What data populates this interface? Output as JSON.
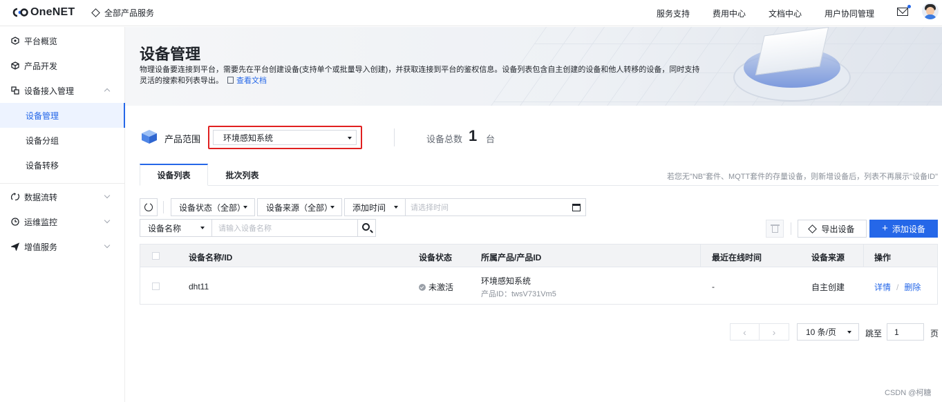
{
  "topbar": {
    "logo_text": "OneNET",
    "all_products": "全部产品服务",
    "nav": [
      "服务支持",
      "费用中心",
      "文档中心",
      "用户协同管理"
    ],
    "icons": {
      "mail": "mail-icon",
      "avatar": "user-avatar"
    }
  },
  "sidebar": {
    "items": [
      {
        "label": "平台概览",
        "icon": "overview-icon"
      },
      {
        "label": "产品开发",
        "icon": "cube-icon"
      },
      {
        "label": "设备接入管理",
        "icon": "device-access-icon"
      },
      {
        "label": "数据流转",
        "icon": "data-flow-icon"
      },
      {
        "label": "运维监控",
        "icon": "monitor-icon"
      },
      {
        "label": "增值服务",
        "icon": "value-added-icon"
      }
    ],
    "sub_items": [
      "设备管理",
      "设备分组",
      "设备转移"
    ],
    "active_sub": "设备管理"
  },
  "banner": {
    "title": "设备管理",
    "desc": "物理设备要连接到平台，需要先在平台创建设备(支持单个或批量导入创建)，并获取连接到平台的鉴权信息。设备列表包含自主创建的设备和他人转移的设备，同时支持灵活的搜索和列表导出。",
    "doc_link": "查看文档"
  },
  "range": {
    "label": "产品范围",
    "selected": "环境感知系统",
    "total_label": "设备总数",
    "total_value": "1",
    "total_unit": "台"
  },
  "tabs": [
    "设备列表",
    "批次列表"
  ],
  "tab_hint": "若您无\"NB\"套件、MQTT套件的存量设备，则新增设备后，列表不再展示\"设备ID\"",
  "filters": {
    "status": "设备状态（全部）",
    "source": "设备来源（全部）",
    "time": "添加时间",
    "date_placeholder": "请选择时间",
    "name_field": "设备名称",
    "search_placeholder": "请输入设备名称"
  },
  "actions": {
    "export": "导出设备",
    "add": "添加设备"
  },
  "table": {
    "headers": [
      "设备名称/ID",
      "设备状态",
      "所属产品/产品ID",
      "最近在线时间",
      "设备来源",
      "操作"
    ],
    "rows": [
      {
        "name": "dht11",
        "status": "未激活",
        "product": "环境感知系统",
        "product_id": "产品ID：twsV731Vm5",
        "last_online": "-",
        "source": "自主创建",
        "op_detail": "详情",
        "op_sep": "/",
        "op_delete": "删除"
      }
    ]
  },
  "pagination": {
    "prev": "‹",
    "next": "›",
    "page_size": "10 条/页",
    "jump_label": "跳至",
    "jump_value": "1",
    "unit": "页"
  },
  "watermark": "CSDN @柯糖",
  "colors": {
    "accent": "#2567e8",
    "highlight_border": "#e02020"
  }
}
